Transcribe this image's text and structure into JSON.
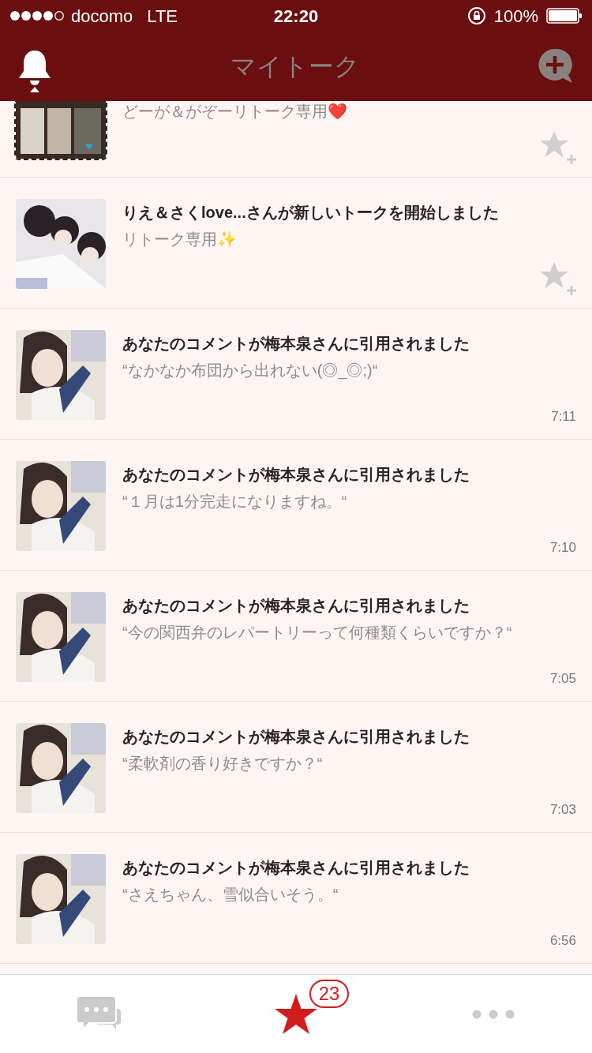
{
  "status_bar": {
    "carrier": "docomo",
    "network": "LTE",
    "time": "22:20",
    "battery": "100%"
  },
  "nav": {
    "title": "マイトーク"
  },
  "rows": [
    {
      "kind": "talk",
      "partial": true,
      "subtitle": "どーが＆がぞーリトーク専用❤️"
    },
    {
      "kind": "talk",
      "partial": false,
      "title": "りえ＆さくlove...さんが新しいトークを開始しました",
      "subtitle": "リトーク専用✨"
    },
    {
      "kind": "quote",
      "partial": false,
      "title": "あなたのコメントが梅本泉さんに引用されました",
      "subtitle": "“なかなか布団から出れない(◎_◎;)“",
      "time": "7:11"
    },
    {
      "kind": "quote",
      "partial": false,
      "title": "あなたのコメントが梅本泉さんに引用されました",
      "subtitle": "“１月は1分完走になりますね。“",
      "time": "7:10"
    },
    {
      "kind": "quote",
      "partial": false,
      "title": "あなたのコメントが梅本泉さんに引用されました",
      "subtitle": "“今の関西弁のレパートリーって何種類くらいですか？“",
      "time": "7:05"
    },
    {
      "kind": "quote",
      "partial": false,
      "title": "あなたのコメントが梅本泉さんに引用されました",
      "subtitle": "“柔軟剤の香り好きですか？“",
      "time": "7:03"
    },
    {
      "kind": "quote",
      "partial": false,
      "title": "あなたのコメントが梅本泉さんに引用されました",
      "subtitle": "“さえちゃん、雪似合いそう。“",
      "time": "6:56"
    }
  ],
  "tabs": [
    {
      "kind": "talks",
      "selected": false
    },
    {
      "kind": "star",
      "selected": true,
      "badge": "23"
    },
    {
      "kind": "more",
      "selected": false
    }
  ]
}
